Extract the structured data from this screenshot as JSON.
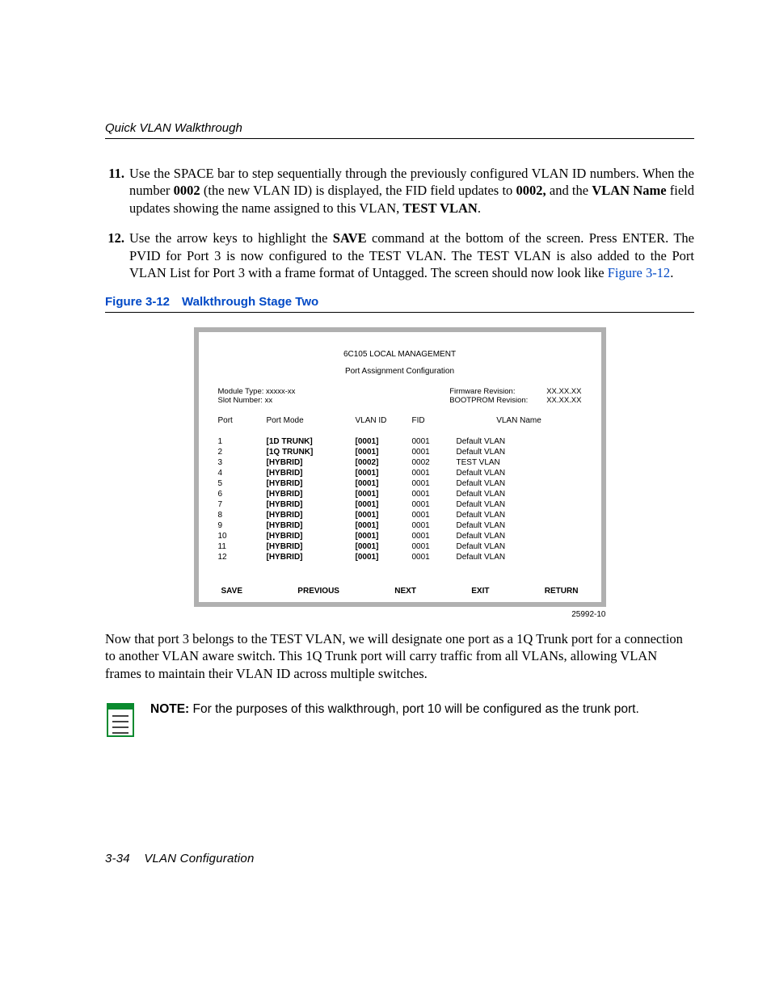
{
  "header": {
    "running_title": "Quick VLAN Walkthrough"
  },
  "steps": {
    "s11": {
      "num": "11.",
      "p1a": "Use the SPACE bar to step sequentially through the previously configured VLAN ID numbers. When the number ",
      "b1": "0002",
      "p1b": " (the new VLAN ID) is displayed, the FID field updates to ",
      "b2": "0002,",
      "p1c": " and the ",
      "b3": "VLAN Name",
      "p1d": " field updates showing the name assigned to this VLAN, ",
      "b4": "TEST VLAN",
      "p1e": "."
    },
    "s12": {
      "num": "12.",
      "p1a": "Use the arrow keys to highlight the ",
      "b1": "SAVE",
      "p1b": " command at the bottom of the screen. Press ENTER. The PVID for Port 3 is now configured to the TEST VLAN. The TEST VLAN is also added to the Port VLAN List for Port 3 with a frame format of Untagged. The screen should now look like ",
      "link": "Figure 3-12",
      "p1c": "."
    }
  },
  "figure": {
    "caption": "Figure 3-12 Walkthrough Stage Two",
    "id_text": "25992-10"
  },
  "screen": {
    "title1": "6C105  LOCAL MANAGEMENT",
    "title2": "Port Assignment Configuration",
    "module_type_lbl": "Module Type: ",
    "module_type_val": "xxxxx-xx",
    "slot_lbl": "Slot Number: ",
    "slot_val": "xx",
    "fw_lbl": "Firmware Revision:",
    "fw_val": "XX.XX.XX",
    "bp_lbl": "BOOTPROM Revision:",
    "bp_val": "XX.XX.XX",
    "head": {
      "port": "Port",
      "mode": "Port Mode",
      "vlan": "VLAN ID",
      "fid": "FID",
      "name": "VLAN Name"
    },
    "rows": [
      {
        "port": "1",
        "mode": "[1D TRUNK]",
        "vlan": "[0001]",
        "fid": "0001",
        "name": "Default  VLAN"
      },
      {
        "port": "2",
        "mode": "[1Q TRUNK]",
        "vlan": "[0001]",
        "fid": "0001",
        "name": "Default  VLAN"
      },
      {
        "port": "3",
        "mode": "[HYBRID]",
        "vlan": "[0002]",
        "fid": "0002",
        "name": "TEST VLAN"
      },
      {
        "port": "4",
        "mode": "[HYBRID]",
        "vlan": "[0001]",
        "fid": "0001",
        "name": "Default  VLAN"
      },
      {
        "port": "5",
        "mode": "[HYBRID]",
        "vlan": "[0001]",
        "fid": "0001",
        "name": "Default  VLAN"
      },
      {
        "port": "6",
        "mode": "[HYBRID]",
        "vlan": "[0001]",
        "fid": "0001",
        "name": "Default  VLAN"
      },
      {
        "port": "7",
        "mode": "[HYBRID]",
        "vlan": "[0001]",
        "fid": "0001",
        "name": "Default  VLAN"
      },
      {
        "port": "8",
        "mode": "[HYBRID]",
        "vlan": "[0001]",
        "fid": "0001",
        "name": "Default  VLAN"
      },
      {
        "port": "9",
        "mode": "[HYBRID]",
        "vlan": "[0001]",
        "fid": "0001",
        "name": "Default  VLAN"
      },
      {
        "port": "10",
        "mode": "[HYBRID]",
        "vlan": "[0001]",
        "fid": "0001",
        "name": "Default  VLAN"
      },
      {
        "port": "11",
        "mode": "[HYBRID]",
        "vlan": "[0001]",
        "fid": "0001",
        "name": "Default  VLAN"
      },
      {
        "port": "12",
        "mode": "[HYBRID]",
        "vlan": "[0001]",
        "fid": "0001",
        "name": "Default  VLAN"
      }
    ],
    "menu": {
      "save": "SAVE",
      "prev": "PREVIOUS",
      "next": "NEXT",
      "exit": "EXIT",
      "ret": "RETURN"
    }
  },
  "para_after": "Now that port 3 belongs to the TEST VLAN, we will designate one port as a 1Q Trunk port for a connection to another VLAN aware switch. This 1Q Trunk port will carry traffic from all VLANs, allowing VLAN frames to maintain their VLAN ID across multiple switches.",
  "note": {
    "label": "NOTE:",
    "text": "  For the purposes of this walkthrough, port 10 will be configured as the trunk port."
  },
  "footer": {
    "page": "3-34",
    "title": "VLAN Configuration"
  }
}
